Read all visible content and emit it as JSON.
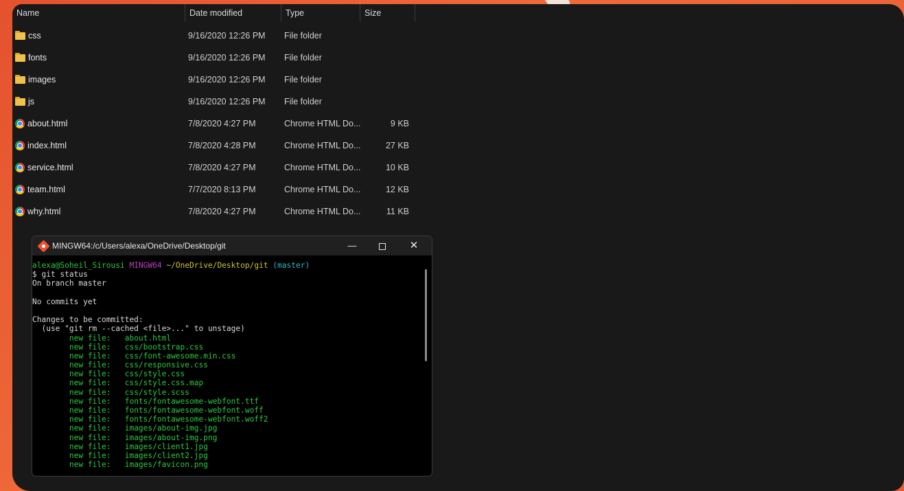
{
  "explorer": {
    "columns": {
      "name": "Name",
      "date": "Date modified",
      "type": "Type",
      "size": "Size"
    },
    "rows": [
      {
        "icon": "folder-icon",
        "name": "css",
        "date": "9/16/2020 12:26 PM",
        "type": "File folder",
        "size": ""
      },
      {
        "icon": "folder-icon",
        "name": "fonts",
        "date": "9/16/2020 12:26 PM",
        "type": "File folder",
        "size": ""
      },
      {
        "icon": "folder-icon",
        "name": "images",
        "date": "9/16/2020 12:26 PM",
        "type": "File folder",
        "size": ""
      },
      {
        "icon": "folder-icon",
        "name": "js",
        "date": "9/16/2020 12:26 PM",
        "type": "File folder",
        "size": ""
      },
      {
        "icon": "chrome-icon",
        "name": "about.html",
        "date": "7/8/2020 4:27 PM",
        "type": "Chrome HTML Do...",
        "size": "9 KB"
      },
      {
        "icon": "chrome-icon",
        "name": "index.html",
        "date": "7/8/2020 4:28 PM",
        "type": "Chrome HTML Do...",
        "size": "27 KB"
      },
      {
        "icon": "chrome-icon",
        "name": "service.html",
        "date": "7/8/2020 4:27 PM",
        "type": "Chrome HTML Do...",
        "size": "10 KB"
      },
      {
        "icon": "chrome-icon",
        "name": "team.html",
        "date": "7/7/2020 8:13 PM",
        "type": "Chrome HTML Do...",
        "size": "12 KB"
      },
      {
        "icon": "chrome-icon",
        "name": "why.html",
        "date": "7/8/2020 4:27 PM",
        "type": "Chrome HTML Do...",
        "size": "11 KB"
      }
    ]
  },
  "terminal": {
    "title": "MINGW64:/c/Users/alexa/OneDrive/Desktop/git",
    "controls": {
      "minimize": "—",
      "close": "✕"
    },
    "prompt": {
      "user": "alexa@Soheil_Sirousi",
      "host": "MINGW64",
      "path": "~/OneDrive/Desktop/git",
      "branch": "(master)"
    },
    "command": "$ git status",
    "output": [
      "On branch master",
      "",
      "No commits yet",
      "",
      "Changes to be committed:",
      "  (use \"git rm --cached <file>...\" to unstage)"
    ],
    "new_file_label": "        new file:   ",
    "new_files": [
      "about.html",
      "css/bootstrap.css",
      "css/font-awesome.min.css",
      "css/responsive.css",
      "css/style.css",
      "css/style.css.map",
      "css/style.scss",
      "fonts/fontawesome-webfont.ttf",
      "fonts/fontawesome-webfont.woff",
      "fonts/fontawesome-webfont.woff2",
      "images/about-img.jpg",
      "images/about-img.png",
      "images/client1.jpg",
      "images/client2.jpg",
      "images/favicon.png"
    ]
  }
}
